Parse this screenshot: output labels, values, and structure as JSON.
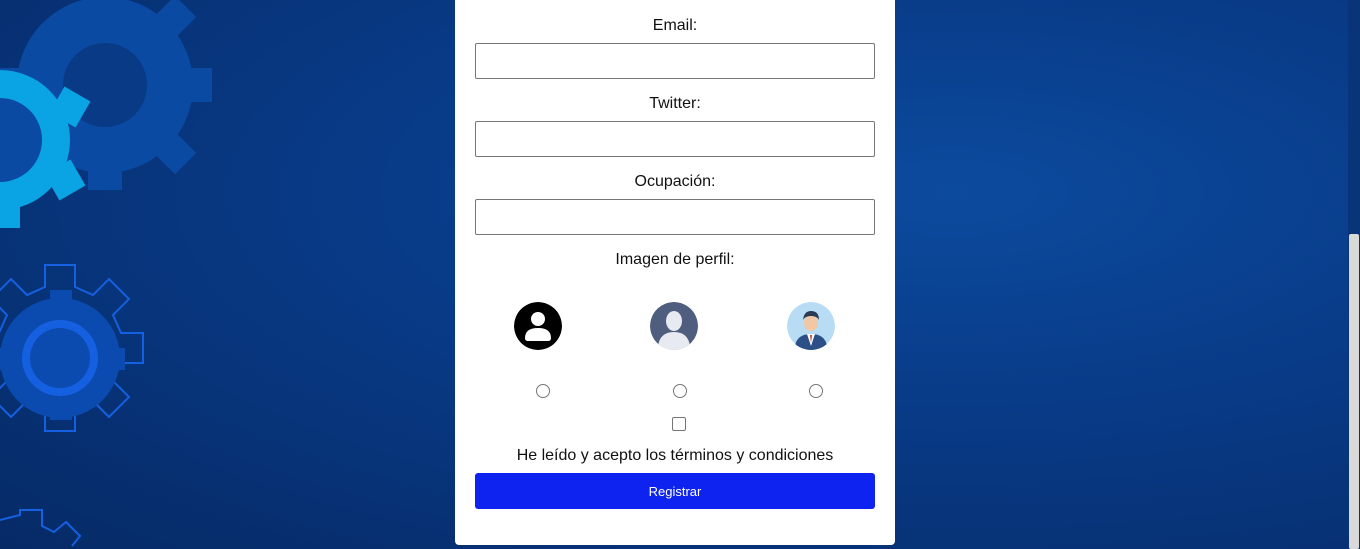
{
  "form": {
    "email_label": "Email:",
    "twitter_label": "Twitter:",
    "occupation_label": "Ocupación:",
    "profile_image_label": "Imagen de perfil:",
    "terms_text": "He leído y acepto los términos y condiciones",
    "submit_label": "Registrar",
    "avatars": [
      {
        "icon": "person-silhouette-black-icon"
      },
      {
        "icon": "person-silhouette-gray-icon"
      },
      {
        "icon": "businessman-avatar-icon"
      }
    ]
  },
  "colors": {
    "background": "#083a86",
    "button": "#0f23f0",
    "gear_dark": "#0a4aa8",
    "gear_light": "#0aa0e0"
  }
}
